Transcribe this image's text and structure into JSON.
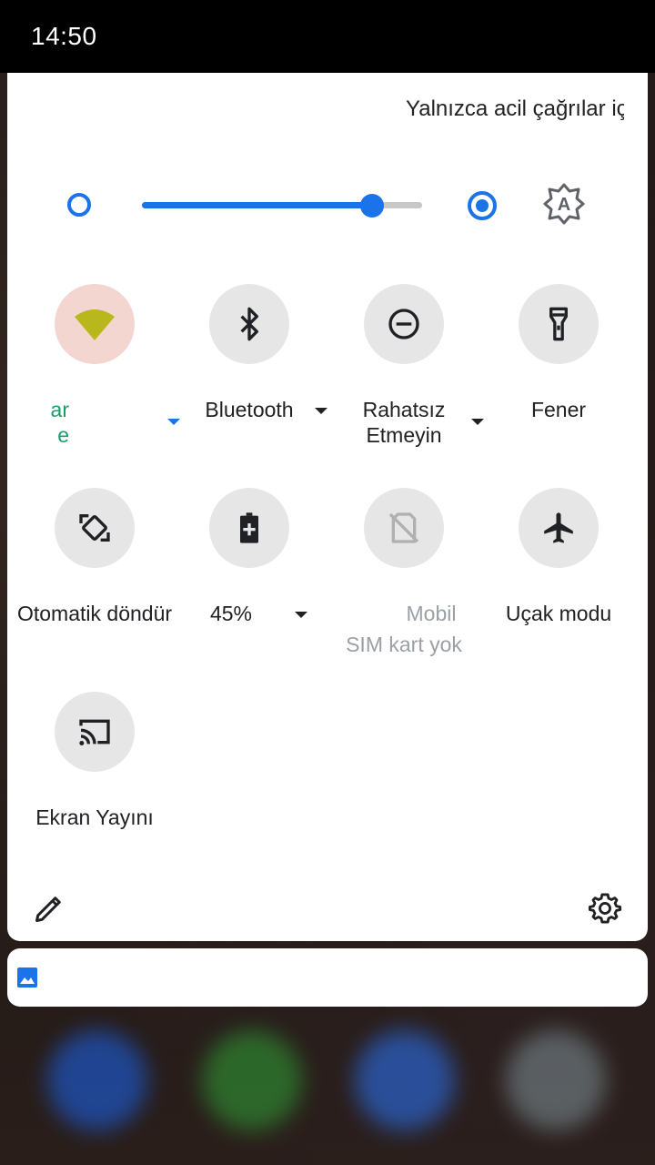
{
  "status_bar": {
    "time": "14:50"
  },
  "carrier_text": "Yalnızca acil çağrılar için",
  "brightness": {
    "level": 0.82
  },
  "tiles": [
    {
      "label": "",
      "sub": "",
      "active": true,
      "icon": "wifi-icon"
    },
    {
      "label": "Bluetooth",
      "sub": "",
      "active": false,
      "icon": "bluetooth-icon"
    },
    {
      "label": "Rahatsız Etmeyin",
      "sub": "",
      "active": false,
      "icon": "do-not-disturb-icon"
    },
    {
      "label": "Fener",
      "sub": "",
      "active": false,
      "icon": "flashlight-icon"
    },
    {
      "label": "Otomatik döndür",
      "sub": "",
      "active": false,
      "icon": "auto-rotate-icon"
    },
    {
      "label": "45%",
      "sub": "",
      "active": false,
      "icon": "battery-saver-icon"
    },
    {
      "label": "Mobil",
      "sub": "SIM kart yok",
      "active": false,
      "icon": "no-sim-icon"
    },
    {
      "label": "Uçak modu",
      "sub": "",
      "active": false,
      "icon": "airplane-icon"
    },
    {
      "label": "Ekran Yayını",
      "sub": "",
      "active": false,
      "icon": "cast-icon"
    }
  ],
  "wifi_label_fragments": {
    "line1": "ar",
    "line2": "e"
  },
  "colors": {
    "accent": "#1a73e8",
    "wifi_tile_bg": "#f2d6cf",
    "wifi_icon": "#b8b81c",
    "wifi_label": "#1a9d6a"
  },
  "footer": {
    "edit_icon": "pencil-icon",
    "settings_icon": "gear-icon"
  },
  "notification": {
    "icon": "image-icon"
  }
}
